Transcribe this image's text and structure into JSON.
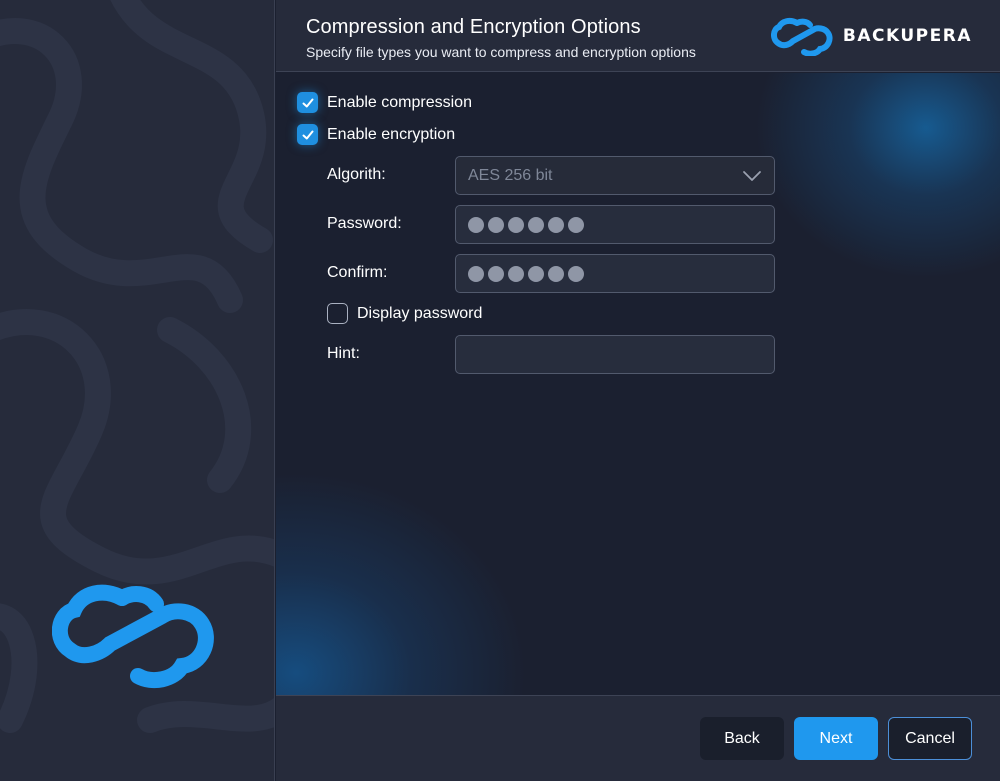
{
  "header": {
    "title": "Compression and Encryption Options",
    "subtitle": "Specify file types you want to compress and encryption options"
  },
  "brand": {
    "name": "BACKUPERA",
    "logo_icon": "cloud-infinity-icon",
    "accent": "#1f98ee"
  },
  "options": {
    "compression": {
      "label": "Enable compression",
      "checked": true
    },
    "encryption": {
      "label": "Enable encryption",
      "checked": true
    },
    "display_password": {
      "label": "Display password",
      "checked": false
    }
  },
  "form": {
    "algorithm": {
      "label": "Algorith:",
      "value": "AES 256 bit"
    },
    "password": {
      "label": "Password:",
      "masked_length": 6
    },
    "confirm": {
      "label": "Confirm:",
      "masked_length": 6
    },
    "hint": {
      "label": "Hint:",
      "value": ""
    }
  },
  "footer": {
    "back": "Back",
    "next": "Next",
    "cancel": "Cancel"
  }
}
